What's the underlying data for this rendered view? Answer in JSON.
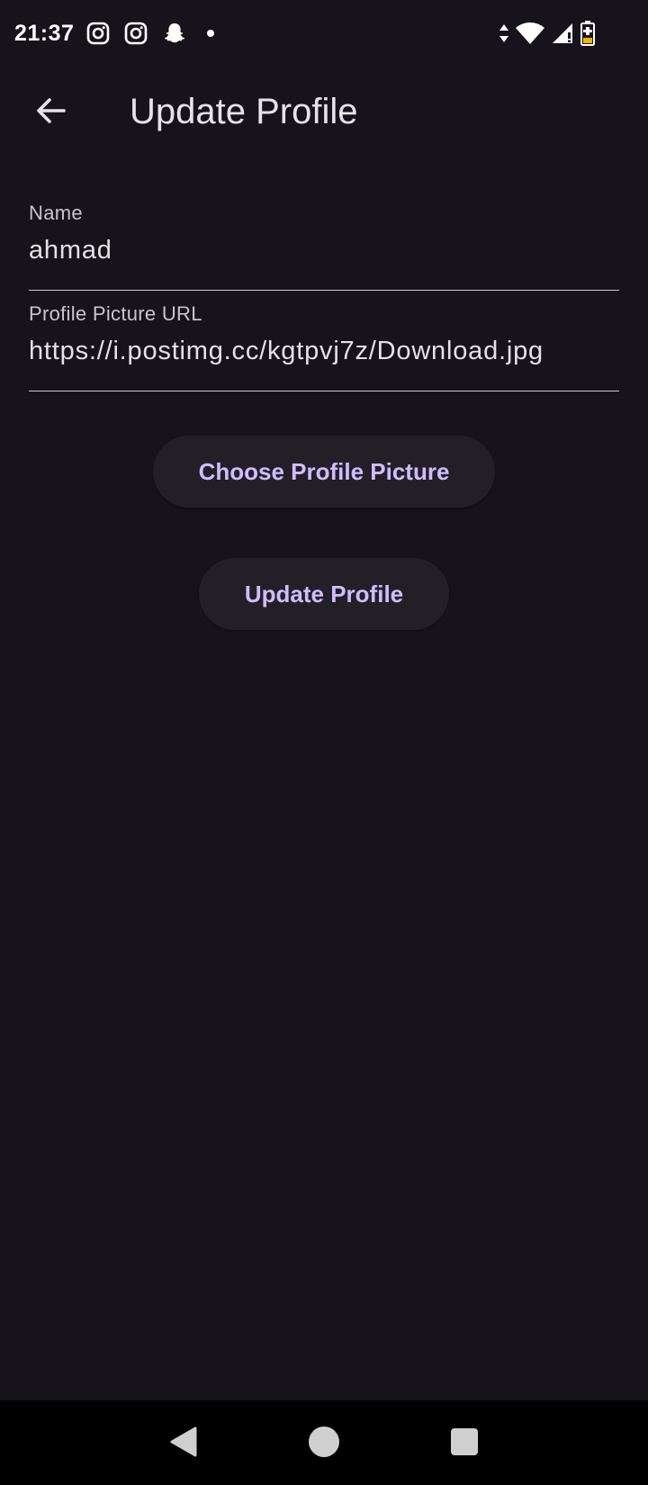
{
  "status_bar": {
    "time": "21:37",
    "notification_icons": [
      "instagram-icon",
      "instagram-icon",
      "snapchat-icon",
      "dot-icon"
    ],
    "system_icons": [
      "data-transfer-icon",
      "wifi-icon",
      "cell-signal-icon",
      "battery-charging-icon"
    ]
  },
  "app_bar": {
    "title": "Update Profile",
    "back_icon": "arrow-left-icon"
  },
  "form": {
    "name": {
      "label": "Name",
      "value": "ahmad"
    },
    "profile_picture_url": {
      "label": "Profile Picture URL",
      "value": "https://i.postimg.cc/kgtpvj7z/Download.jpg"
    }
  },
  "buttons": {
    "choose_picture": "Choose Profile Picture",
    "update_profile": "Update Profile"
  },
  "nav_bar": {
    "icons": [
      "back-triangle-icon",
      "home-circle-icon",
      "recents-square-icon"
    ]
  },
  "colors": {
    "background": "#16131b",
    "accent": "#d0bcff",
    "button_bg": "#221f27",
    "nav_bg": "#000000"
  }
}
